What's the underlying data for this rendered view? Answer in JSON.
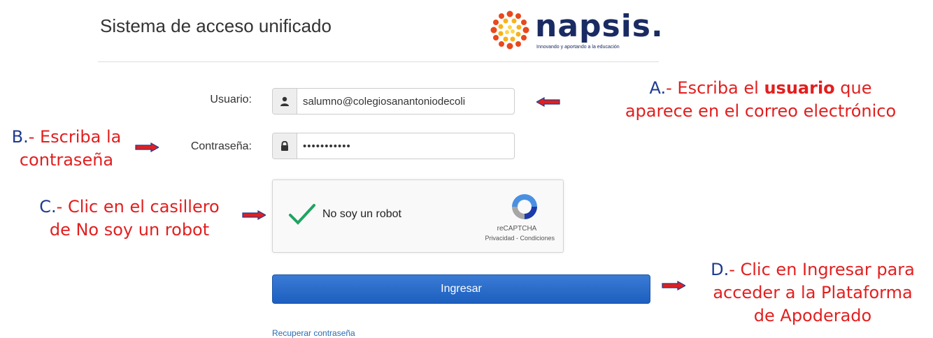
{
  "header": {
    "title": "Sistema de acceso unificado",
    "logo_word": "napsis.",
    "logo_tagline": "Innovando y aportando a la educación"
  },
  "form": {
    "usuario_label": "Usuario:",
    "usuario_value": "salumno@colegiosanantoniodecoli",
    "password_label": "Contraseña:",
    "password_value": "•••••••••••"
  },
  "captcha": {
    "label": "No soy un robot",
    "brand": "reCAPTCHA",
    "privacy": "Privacidad",
    "sep": " - ",
    "terms": "Condiciones"
  },
  "button": {
    "label": "Ingresar"
  },
  "recover_link": "Recuperar contraseña",
  "annotations": {
    "a": {
      "prefix": "A.",
      "text1": "- Escriba el ",
      "bold": "usuario",
      "text2": " que",
      "line2": "aparece en el correo electrónico"
    },
    "b": {
      "prefix": "B.",
      "line1": "- Escriba la",
      "line2": "contraseña"
    },
    "c": {
      "prefix": "C.",
      "line1": "- Clic en el casillero",
      "line2": "de No soy un robot"
    },
    "d": {
      "prefix": "D.",
      "line1": "- Clic en Ingresar para",
      "line2": "acceder a la Plataforma",
      "line3": "de Apoderado"
    }
  },
  "colors": {
    "annotation_red": "#e21f1f",
    "annotation_navy": "#1f3b8f",
    "button_blue": "#2a6ccb",
    "link_blue": "#2b6cb0",
    "checkmark_green": "#1fa463"
  }
}
